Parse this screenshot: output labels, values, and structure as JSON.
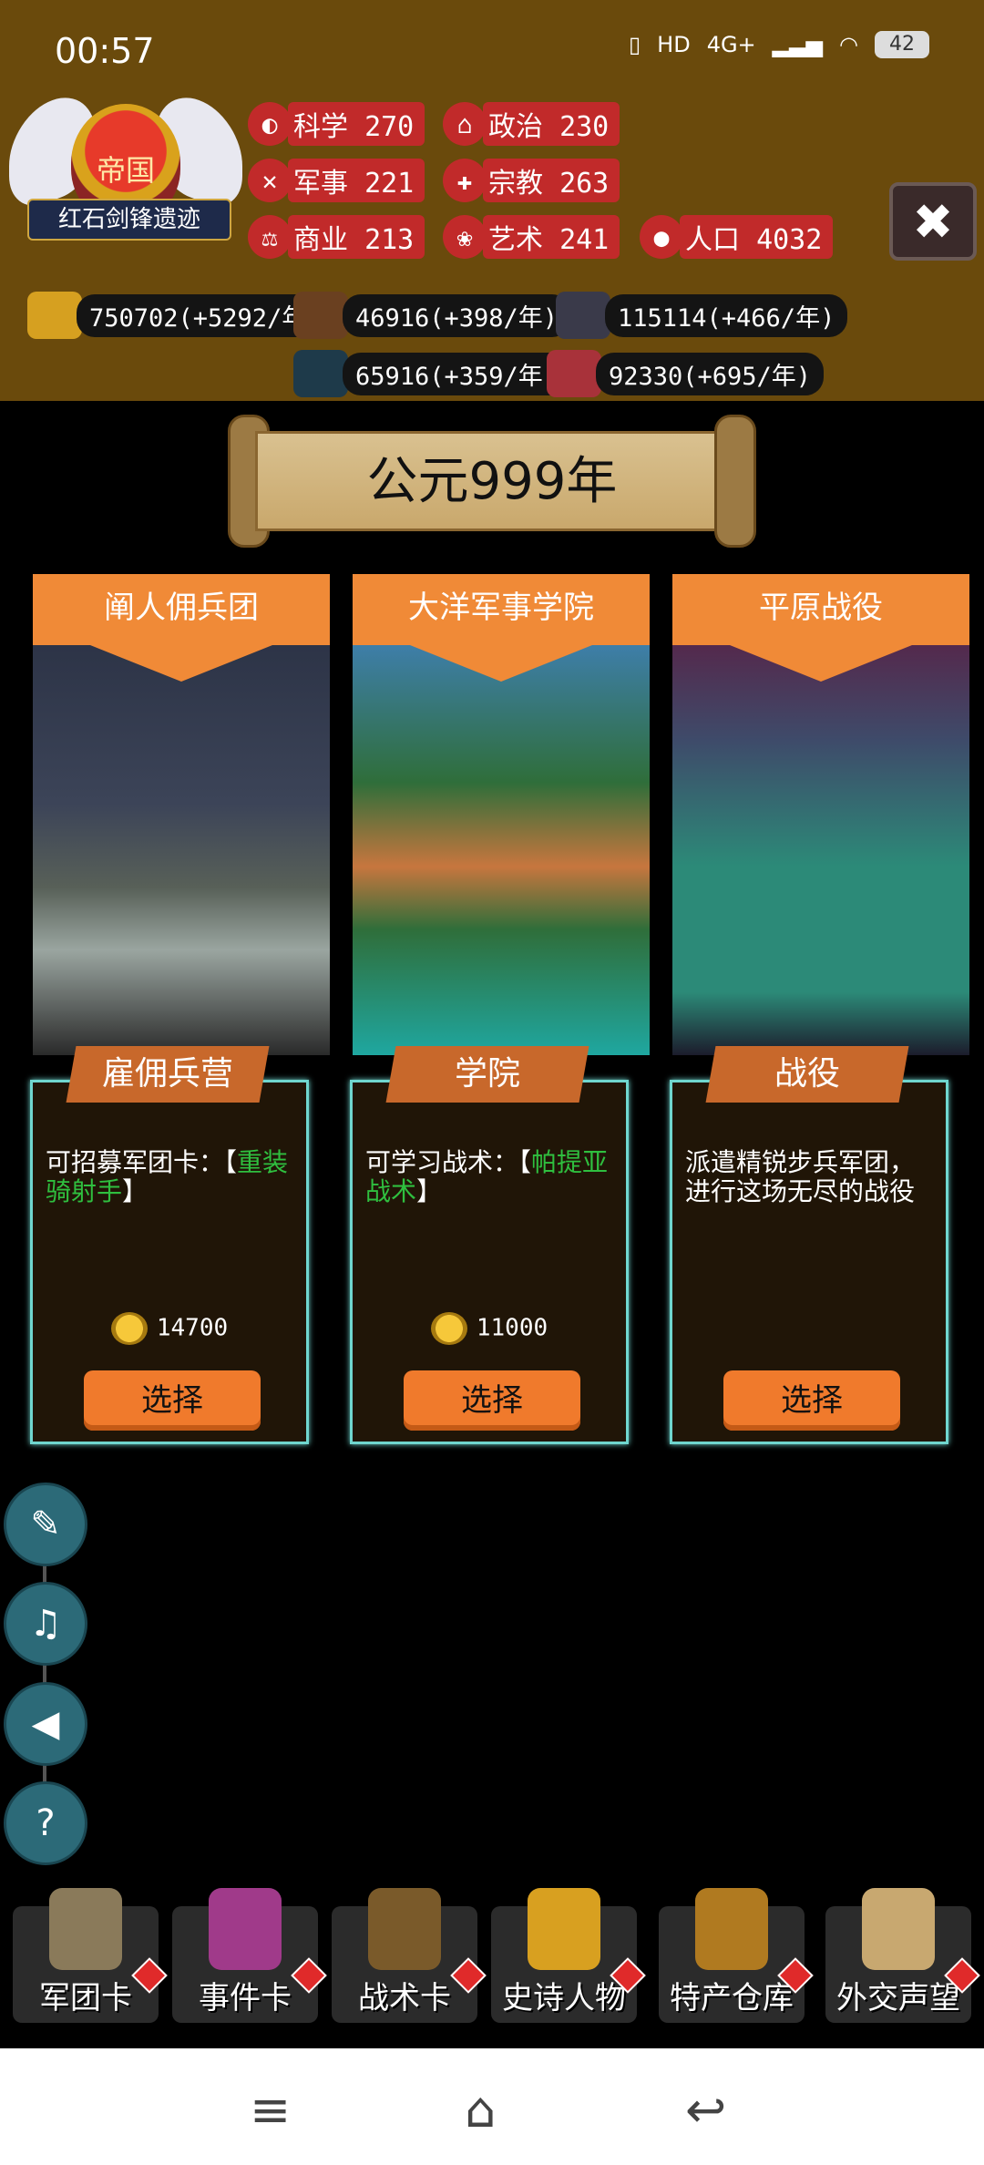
{
  "status_bar": {
    "time": "00:57",
    "network": "4G+",
    "battery": "42"
  },
  "header": {
    "emblem_title": "帝国",
    "emblem_name": "红石剑锋遗迹",
    "stats": [
      {
        "label": "科学",
        "value": "270"
      },
      {
        "label": "政治",
        "value": "230"
      },
      {
        "label": "军事",
        "value": "221"
      },
      {
        "label": "宗教",
        "value": "263"
      },
      {
        "label": "商业",
        "value": "213"
      },
      {
        "label": "艺术",
        "value": "241"
      },
      {
        "label": "人口",
        "value": "4032"
      }
    ],
    "resources": [
      "750702(+5292/年)",
      "46916(+398/年)",
      "115114(+466/年)",
      "65916(+359/年)",
      "92330(+695/年)"
    ]
  },
  "year_banner": "公元999年",
  "cards": [
    {
      "title": "阐人佣兵团",
      "tab": "雇佣兵营",
      "desc_prefix": "可招募军团卡：【",
      "desc_highlight": "重装骑射手",
      "desc_suffix": "】",
      "cost": "14700",
      "button": "选择"
    },
    {
      "title": "大洋军事学院",
      "tab": "学院",
      "desc_prefix": "可学习战术：【",
      "desc_highlight": "帕提亚战术",
      "desc_suffix": "】",
      "cost": "11000",
      "button": "选择"
    },
    {
      "title": "平原战役",
      "tab": "战役",
      "desc_prefix": "派遣精锐步兵军团，进行这场无尽的战役",
      "desc_highlight": "",
      "desc_suffix": "",
      "cost": "",
      "button": "选择"
    }
  ],
  "bottom_tabs": [
    {
      "label": "军团卡",
      "icon": "helmet-icon"
    },
    {
      "label": "事件卡",
      "icon": "scroll-icon"
    },
    {
      "label": "战术卡",
      "icon": "shield-axes-icon"
    },
    {
      "label": "史诗人物",
      "icon": "crown-icon"
    },
    {
      "label": "特产仓库",
      "icon": "chest-icon"
    },
    {
      "label": "外交声望",
      "icon": "envelope-icon"
    }
  ],
  "colors": {
    "header_bg": "#6a4a0c",
    "card_title": "#f08a37",
    "panel_border": "#6fd6cf",
    "button": "#f07a2c",
    "highlight": "#2fbf3f"
  }
}
